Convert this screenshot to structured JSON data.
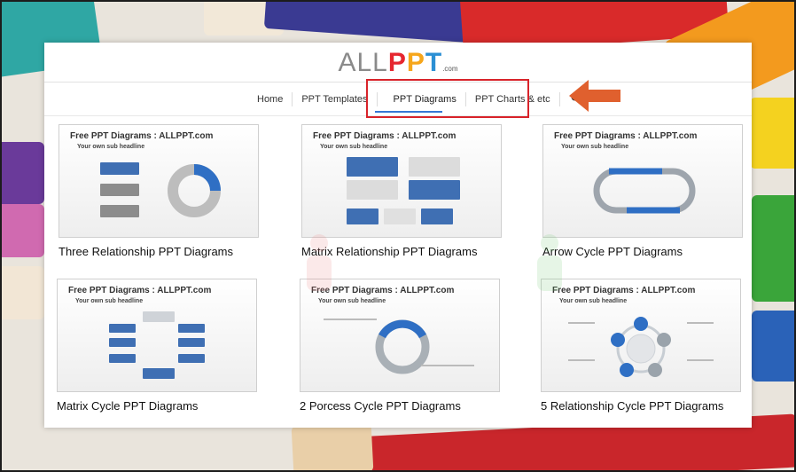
{
  "logo": {
    "all": "ALL",
    "p1": "P",
    "p2": "P",
    "t": "T",
    "com": ".com"
  },
  "nav": {
    "items": [
      "Home",
      "PPT Templates",
      "PPT Diagrams",
      "PPT Charts & etc"
    ],
    "active": "PPT Diagrams",
    "search_icon": "search-icon"
  },
  "annotation": {
    "highlight_color": "#d8232a",
    "arrow_color": "#e06030"
  },
  "thumb_common": {
    "title": "Free PPT Diagrams : ALLPPT.com",
    "subtitle": "Your own sub headline"
  },
  "tiles": [
    {
      "caption": "Three Relationship PPT Diagrams"
    },
    {
      "caption": "Matrix Relationship PPT Diagrams"
    },
    {
      "caption": "Arrow Cycle PPT Diagrams"
    },
    {
      "caption": "Matrix Cycle PPT Diagrams"
    },
    {
      "caption": "2 Porcess Cycle PPT Diagrams"
    },
    {
      "caption": "5 Relationship Cycle PPT Diagrams"
    }
  ]
}
